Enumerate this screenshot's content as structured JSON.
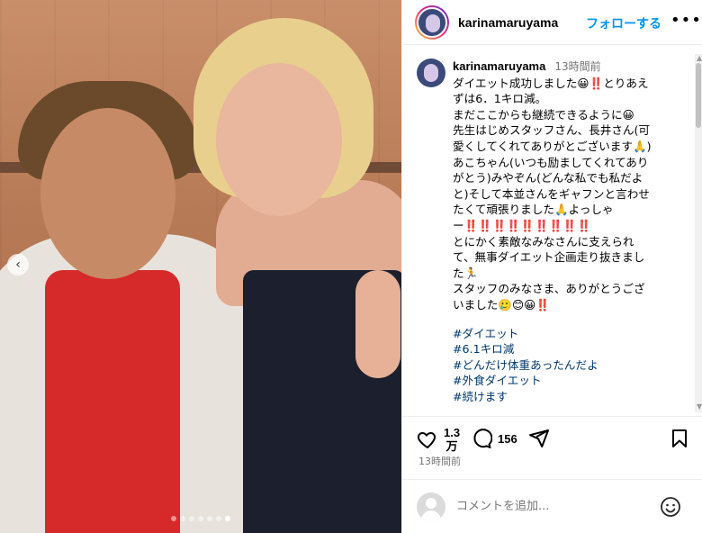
{
  "post": {
    "username": "karinamaruyama",
    "follow_label": "フォローする",
    "more_label": "•••",
    "caption": {
      "username": "karinamaruyama",
      "time": "13時間前",
      "lines": [
        "ダイエット成功しました😀‼️とりあえ",
        "ずは6．1キロ減。",
        "まだここからも継続できるように😀",
        "先生はじめスタッフさん、長井さん(可",
        "愛くしてくれてありがとございます🙏)",
        "あこちゃん(いつも励ましてくれてあり",
        "がとう)みやぞん(どんな私でも私だよ",
        "と)そして本並さんをギャフンと言わせ",
        "たくて頑張りました🙏よっしゃ",
        "ー‼️‼️‼️‼️‼️‼️‼️‼️‼️",
        "とにかく素敵なみなさんに支えられ",
        "て、無事ダイエット企画走り抜きまし",
        "た🏃",
        "スタッフのみなさま、ありがとうござ",
        "いました🥲😊😀‼️"
      ],
      "hashtags": [
        "#ダイエット",
        "#6.1キロ減",
        "#どんだけ体重あったんだよ",
        "#外食ダイエット",
        "#続けます"
      ]
    },
    "likes": {
      "line1": "1.3",
      "line2": "万"
    },
    "comment_count": "156",
    "posted": "13時間前",
    "comment_placeholder": "コメントを追加...",
    "carousel": {
      "dot_count": 7,
      "active_index": 6
    }
  }
}
